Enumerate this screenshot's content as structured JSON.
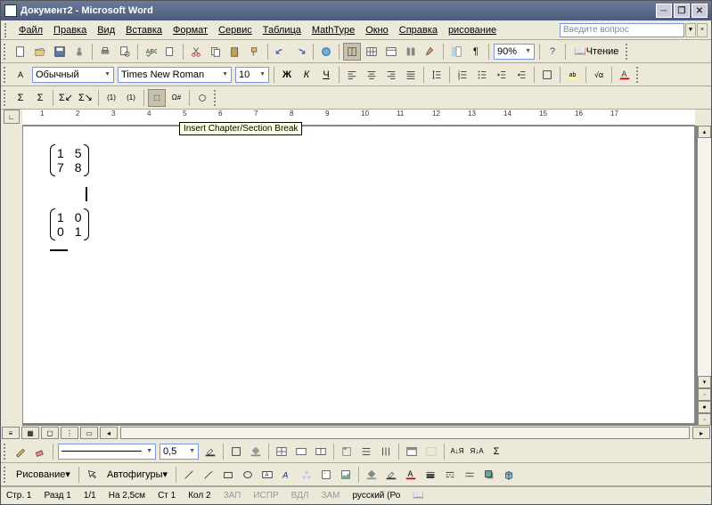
{
  "title": "Документ2 - Microsoft Word",
  "menu": [
    "Файл",
    "Правка",
    "Вид",
    "Вставка",
    "Формат",
    "Сервис",
    "Таблица",
    "MathType",
    "Окно",
    "Справка",
    "рисование"
  ],
  "ask_placeholder": "Введите вопрос",
  "zoom": "90%",
  "reading": "Чтение",
  "style": "Обычный",
  "font": "Times New Roman",
  "size": "10",
  "bold": "Ж",
  "italic": "К",
  "under": "Ч",
  "tooltip": "Insert Chapter/Section Break",
  "matrix1": [
    [
      "1",
      "5"
    ],
    [
      "7",
      "8"
    ]
  ],
  "matrix2": [
    [
      "1",
      "0"
    ],
    [
      "0",
      "1"
    ]
  ],
  "lineweight": "0,5",
  "drawing_label": "Рисование",
  "autoshapes": "Автофигуры",
  "ruler_marks": [
    "1",
    "2",
    "3",
    "4",
    "5",
    "6",
    "7",
    "8",
    "9",
    "10",
    "11",
    "12",
    "13",
    "14",
    "15",
    "16",
    "17"
  ],
  "status": {
    "page": "Стр. 1",
    "sect": "Разд 1",
    "pages": "1/1",
    "at": "На 2,5см",
    "line": "Ст 1",
    "col": "Кол 2",
    "rec": "ЗАП",
    "trk": "ИСПР",
    "ext": "ВДЛ",
    "ovr": "ЗАМ",
    "lang": "русский (Ро"
  }
}
